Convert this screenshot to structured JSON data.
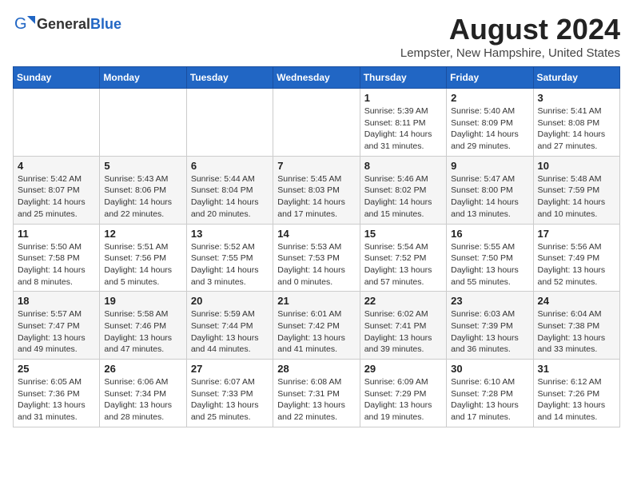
{
  "header": {
    "logo_general": "General",
    "logo_blue": "Blue",
    "month_year": "August 2024",
    "location": "Lempster, New Hampshire, United States"
  },
  "days_of_week": [
    "Sunday",
    "Monday",
    "Tuesday",
    "Wednesday",
    "Thursday",
    "Friday",
    "Saturday"
  ],
  "weeks": [
    [
      {
        "day": "",
        "info": ""
      },
      {
        "day": "",
        "info": ""
      },
      {
        "day": "",
        "info": ""
      },
      {
        "day": "",
        "info": ""
      },
      {
        "day": "1",
        "info": "Sunrise: 5:39 AM\nSunset: 8:11 PM\nDaylight: 14 hours\nand 31 minutes."
      },
      {
        "day": "2",
        "info": "Sunrise: 5:40 AM\nSunset: 8:09 PM\nDaylight: 14 hours\nand 29 minutes."
      },
      {
        "day": "3",
        "info": "Sunrise: 5:41 AM\nSunset: 8:08 PM\nDaylight: 14 hours\nand 27 minutes."
      }
    ],
    [
      {
        "day": "4",
        "info": "Sunrise: 5:42 AM\nSunset: 8:07 PM\nDaylight: 14 hours\nand 25 minutes."
      },
      {
        "day": "5",
        "info": "Sunrise: 5:43 AM\nSunset: 8:06 PM\nDaylight: 14 hours\nand 22 minutes."
      },
      {
        "day": "6",
        "info": "Sunrise: 5:44 AM\nSunset: 8:04 PM\nDaylight: 14 hours\nand 20 minutes."
      },
      {
        "day": "7",
        "info": "Sunrise: 5:45 AM\nSunset: 8:03 PM\nDaylight: 14 hours\nand 17 minutes."
      },
      {
        "day": "8",
        "info": "Sunrise: 5:46 AM\nSunset: 8:02 PM\nDaylight: 14 hours\nand 15 minutes."
      },
      {
        "day": "9",
        "info": "Sunrise: 5:47 AM\nSunset: 8:00 PM\nDaylight: 14 hours\nand 13 minutes."
      },
      {
        "day": "10",
        "info": "Sunrise: 5:48 AM\nSunset: 7:59 PM\nDaylight: 14 hours\nand 10 minutes."
      }
    ],
    [
      {
        "day": "11",
        "info": "Sunrise: 5:50 AM\nSunset: 7:58 PM\nDaylight: 14 hours\nand 8 minutes."
      },
      {
        "day": "12",
        "info": "Sunrise: 5:51 AM\nSunset: 7:56 PM\nDaylight: 14 hours\nand 5 minutes."
      },
      {
        "day": "13",
        "info": "Sunrise: 5:52 AM\nSunset: 7:55 PM\nDaylight: 14 hours\nand 3 minutes."
      },
      {
        "day": "14",
        "info": "Sunrise: 5:53 AM\nSunset: 7:53 PM\nDaylight: 14 hours\nand 0 minutes."
      },
      {
        "day": "15",
        "info": "Sunrise: 5:54 AM\nSunset: 7:52 PM\nDaylight: 13 hours\nand 57 minutes."
      },
      {
        "day": "16",
        "info": "Sunrise: 5:55 AM\nSunset: 7:50 PM\nDaylight: 13 hours\nand 55 minutes."
      },
      {
        "day": "17",
        "info": "Sunrise: 5:56 AM\nSunset: 7:49 PM\nDaylight: 13 hours\nand 52 minutes."
      }
    ],
    [
      {
        "day": "18",
        "info": "Sunrise: 5:57 AM\nSunset: 7:47 PM\nDaylight: 13 hours\nand 49 minutes."
      },
      {
        "day": "19",
        "info": "Sunrise: 5:58 AM\nSunset: 7:46 PM\nDaylight: 13 hours\nand 47 minutes."
      },
      {
        "day": "20",
        "info": "Sunrise: 5:59 AM\nSunset: 7:44 PM\nDaylight: 13 hours\nand 44 minutes."
      },
      {
        "day": "21",
        "info": "Sunrise: 6:01 AM\nSunset: 7:42 PM\nDaylight: 13 hours\nand 41 minutes."
      },
      {
        "day": "22",
        "info": "Sunrise: 6:02 AM\nSunset: 7:41 PM\nDaylight: 13 hours\nand 39 minutes."
      },
      {
        "day": "23",
        "info": "Sunrise: 6:03 AM\nSunset: 7:39 PM\nDaylight: 13 hours\nand 36 minutes."
      },
      {
        "day": "24",
        "info": "Sunrise: 6:04 AM\nSunset: 7:38 PM\nDaylight: 13 hours\nand 33 minutes."
      }
    ],
    [
      {
        "day": "25",
        "info": "Sunrise: 6:05 AM\nSunset: 7:36 PM\nDaylight: 13 hours\nand 31 minutes."
      },
      {
        "day": "26",
        "info": "Sunrise: 6:06 AM\nSunset: 7:34 PM\nDaylight: 13 hours\nand 28 minutes."
      },
      {
        "day": "27",
        "info": "Sunrise: 6:07 AM\nSunset: 7:33 PM\nDaylight: 13 hours\nand 25 minutes."
      },
      {
        "day": "28",
        "info": "Sunrise: 6:08 AM\nSunset: 7:31 PM\nDaylight: 13 hours\nand 22 minutes."
      },
      {
        "day": "29",
        "info": "Sunrise: 6:09 AM\nSunset: 7:29 PM\nDaylight: 13 hours\nand 19 minutes."
      },
      {
        "day": "30",
        "info": "Sunrise: 6:10 AM\nSunset: 7:28 PM\nDaylight: 13 hours\nand 17 minutes."
      },
      {
        "day": "31",
        "info": "Sunrise: 6:12 AM\nSunset: 7:26 PM\nDaylight: 13 hours\nand 14 minutes."
      }
    ]
  ]
}
